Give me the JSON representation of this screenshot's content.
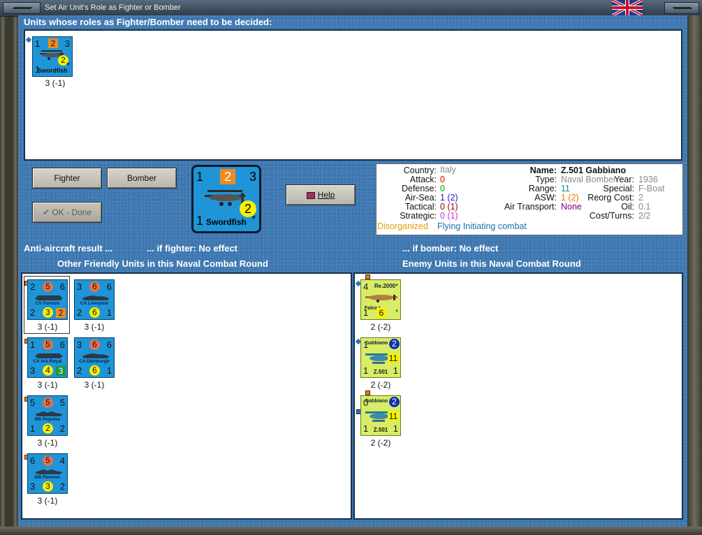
{
  "window": {
    "title": "Set Air Unit's Role as Fighter or Bomber"
  },
  "undecided": {
    "heading": "Units whose roles as Fighter/Bomber need to be decided:",
    "units": [
      {
        "tl": "1",
        "top_box": "2",
        "tr": "3",
        "mid_circle": "2",
        "bl": "1",
        "name": "Swordfish",
        "br": "*",
        "strength": "3 (-1)"
      }
    ]
  },
  "buttons": {
    "fighter": "Fighter",
    "bomber": "Bomber",
    "ok_done": "OK - Done",
    "help": "Help"
  },
  "selected_counter": {
    "tl": "1",
    "top_box": "2",
    "tr": "3",
    "mid_circle": "2",
    "bl": "1",
    "name": "Swordfish",
    "br": "*"
  },
  "info": {
    "country_label": "Country:",
    "country": "Italy",
    "attack_label": "Attack:",
    "attack": "0",
    "defense_label": "Defense:",
    "defense": "0",
    "airsea_label": "Air-Sea:",
    "airsea": "1 (2)",
    "tactical_label": "Tactical:",
    "tactical": "0 (1)",
    "strategic_label": "Strategic:",
    "strategic": "0 (1)",
    "name_label": "Name:",
    "name": "Z.501 Gabbiano",
    "type_label": "Type:",
    "type": "Naval Bomber",
    "year_label": "Year:",
    "year": "1936",
    "range_label": "Range:",
    "range": "11",
    "special_label": "Special:",
    "special": "F-Boat",
    "asw_label": "ASW:",
    "asw": "1 (2)",
    "reorg_label": "Reorg Cost:",
    "reorg": "2",
    "airtransport_label": "Air Transport:",
    "airtransport": "None",
    "oil_label": "Oil:",
    "oil": "0.1",
    "costturns_label": "Cost/Turns:",
    "costturns": "2/2",
    "status_disorganized": "Disorganized",
    "status_flying": "Flying Initiating combat"
  },
  "aa_result": {
    "label": "Anti-aircraft result ...",
    "fighter": "... if fighter:  No effect",
    "bomber": "... if bomber:  No effect"
  },
  "friendly": {
    "heading": "Other Friendly Units in this Naval Combat Round",
    "units": [
      {
        "tl": "2",
        "tc": "5",
        "tr": "6",
        "name": "CV Furious",
        "bl": "2",
        "bc": "3",
        "br": "2",
        "strength": "3 (-1)"
      },
      {
        "tl": "3",
        "tc": "6",
        "tr": "6",
        "name": "CA Liverpool",
        "bl": "2",
        "bc": "6",
        "br": "1",
        "strength": "3 (-1)"
      },
      {
        "tl": "1",
        "tc": "5",
        "tr": "6",
        "name": "CV Ark Royal",
        "bl": "3",
        "bc": "4",
        "br": "3",
        "strength": "3 (-1)"
      },
      {
        "tl": "3",
        "tc": "6",
        "tr": "6",
        "name": "CA Edinburgh",
        "bl": "2",
        "bc": "6",
        "br": "1",
        "strength": "3 (-1)"
      },
      {
        "tl": "5",
        "tc": "5",
        "tr": "5",
        "name": "BB Repulse",
        "bl": "1",
        "bc": "2",
        "br": "2",
        "strength": "3 (-1)"
      },
      {
        "tl": "6",
        "tc": "5",
        "tr": "4",
        "name": "BB Renown",
        "bl": "3",
        "bc": "3",
        "br": "2",
        "strength": "3 (-1)"
      }
    ]
  },
  "enemy": {
    "heading": "Enemy Units in this Naval Combat Round",
    "units": [
      {
        "tl": "4",
        "name_top": "Re.2000",
        "tr": "*",
        "name_bottom": "Falco I",
        "bl": "1",
        "bc": "6",
        "br": "*",
        "strength": "2 (-2)"
      },
      {
        "tl": "1",
        "name_top": "Gabbiano",
        "tr": "2",
        "mid": "11",
        "bl": "1",
        "name_bottom": "Z.501",
        "br": "1",
        "strength": "2 (-2)"
      },
      {
        "tl": "0",
        "name_top": "Gabbiano",
        "tr": "2",
        "mid": "11",
        "bl": "1",
        "name_bottom": "Z.501",
        "br": "1",
        "strength": "2 (-2)"
      }
    ]
  },
  "colors": {
    "panel_blue": "#3f79b3",
    "counter_blue": "#1f95d8",
    "counter_yellow": "#d8ec66",
    "circle_orange": "#e8714a",
    "circle_yellow": "#f8f000",
    "green_box": "#1a9a3a"
  },
  "icons": [
    "swordfish-plane-icon",
    "ship-silhouette-icon",
    "seaplane-icon",
    "help-book-icon",
    "checkmark-icon",
    "union-jack-flag-icon"
  ]
}
